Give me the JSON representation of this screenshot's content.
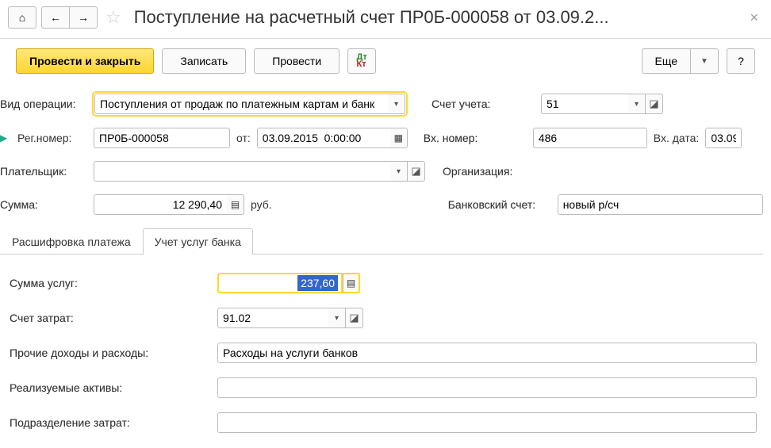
{
  "header": {
    "title": "Поступление на расчетный счет ПР0Б-000058 от 03.09.2..."
  },
  "toolbar": {
    "post_close": "Провести и закрыть",
    "save": "Записать",
    "post": "Провести",
    "more": "Еще",
    "help": "?"
  },
  "form": {
    "op_type_label": "Вид операции:",
    "op_type_value": "Поступления от продаж по платежным картам и банк",
    "account_label": "Счет учета:",
    "account_value": "51",
    "reg_num_label": "Рег.номер:",
    "reg_num_value": "ПР0Б-000058",
    "from_label": "от:",
    "from_value": "03.09.2015  0:00:00",
    "in_num_label": "Вх. номер:",
    "in_num_value": "486",
    "in_date_label": "Вх. дата:",
    "in_date_value": "03.09.",
    "payer_label": "Плательщик:",
    "payer_value": "",
    "org_label": "Организация:",
    "sum_label": "Сумма:",
    "sum_value": "12 290,40",
    "currency": "руб.",
    "bank_acc_label": "Банковский счет:",
    "bank_acc_value": "новый р/сч"
  },
  "tabs": {
    "t1": "Расшифровка платежа",
    "t2": "Учет услуг банка"
  },
  "tab2": {
    "service_sum_label": "Сумма услуг:",
    "service_sum_value": "237,60",
    "cost_acc_label": "Счет затрат:",
    "cost_acc_value": "91.02",
    "other_inc_label": "Прочие доходы и расходы:",
    "other_inc_value": "Расходы на услуги банков",
    "assets_label": "Реализуемые активы:",
    "dept_label": "Подразделение затрат:"
  }
}
